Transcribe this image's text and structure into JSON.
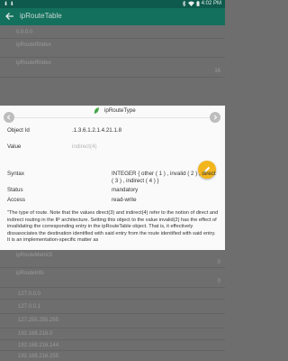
{
  "status_bar": {
    "time": "4:02 PM"
  },
  "app_bar": {
    "title": "ipRouteTable"
  },
  "list_top": [
    {
      "label": "0.0.0.0",
      "value": ""
    },
    {
      "label": "ipRouteIfIndex",
      "value": ""
    },
    {
      "label": "ipRouteIfIndex",
      "value": "16"
    }
  ],
  "dialog": {
    "title": "ipRouteType",
    "object_id_label": "Object Id",
    "object_id_value": ".1.3.6.1.2.1.4.21.1.8",
    "value_label": "Value",
    "value_value": "indirect(4)",
    "syntax_label": "Syntax",
    "syntax_value_line1": "INTEGER { other ( 1 ) , invalid ( 2 ) , direct",
    "syntax_value_line2": "( 3 ) , indirect ( 4 ) }",
    "status_label": "Status",
    "status_value": "mandatory",
    "access_label": "Access",
    "access_value": "read-write",
    "description": "\"The type of route. Note that the values direct(3) and indirect(4) refer to the notion of direct and indirect routing in the IP architecture. Setting this object to the value invalid(2) has the effect of invalidating the corresponding entry in the ipRouteTable object. That is, it effectively dissasociates the destination identified with said entry from the route identified with said entry. It is an implementation-specific matter as"
  },
  "list_bottom": [
    {
      "label": "ipRouteMetric5",
      "value": "0"
    },
    {
      "label": "ipRouteInfo",
      "value": "0"
    },
    {
      "label": "127.0.0.0",
      "value": ""
    },
    {
      "label": "127.0.0.1",
      "value": ""
    },
    {
      "label": "127.255.255.255",
      "value": ""
    },
    {
      "label": "192.168.216.0",
      "value": ""
    },
    {
      "label": "192.168.216.144",
      "value": ""
    },
    {
      "label": "192.168.216.255",
      "value": ""
    }
  ],
  "colors": {
    "status_bar": "#0e5a4c",
    "app_bar": "#13705d",
    "fab": "#f3b51c",
    "dialog_icon": "#4caf50"
  }
}
